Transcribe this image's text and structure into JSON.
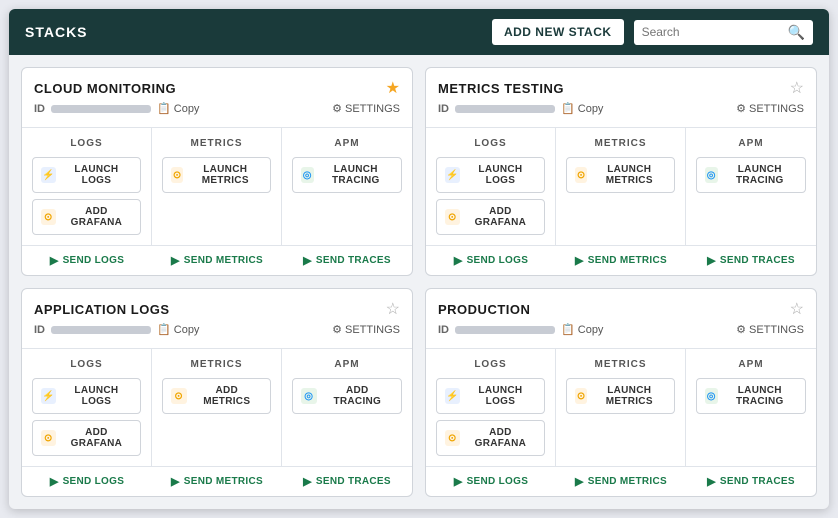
{
  "header": {
    "title": "STACKS",
    "add_button_label": "ADD NEW STACK",
    "search_placeholder": "Search"
  },
  "stacks": [
    {
      "id": "cloud-monitoring",
      "name": "CLOUD MONITORING",
      "starred": true,
      "id_label": "ID",
      "copy_label": "Copy",
      "settings_label": "SETTINGS",
      "services": [
        {
          "title": "LOGS",
          "buttons": [
            {
              "label": "LAUNCH LOGS",
              "type": "logs"
            },
            {
              "label": "ADD GRAFANA",
              "type": "grafana"
            }
          ]
        },
        {
          "title": "METRICS",
          "buttons": [
            {
              "label": "LAUNCH METRICS",
              "type": "metrics"
            }
          ]
        },
        {
          "title": "APM",
          "buttons": [
            {
              "label": "LAUNCH TRACING",
              "type": "apm"
            }
          ]
        }
      ],
      "send_buttons": [
        "SEND LOGS",
        "SEND METRICS",
        "SEND TRACES"
      ]
    },
    {
      "id": "metrics-testing",
      "name": "METRICS TESTING",
      "starred": false,
      "id_label": "ID",
      "copy_label": "Copy",
      "settings_label": "SETTINGS",
      "services": [
        {
          "title": "LOGS",
          "buttons": [
            {
              "label": "LAUNCH LOGS",
              "type": "logs"
            },
            {
              "label": "ADD GRAFANA",
              "type": "grafana"
            }
          ]
        },
        {
          "title": "METRICS",
          "buttons": [
            {
              "label": "LAUNCH METRICS",
              "type": "metrics"
            }
          ]
        },
        {
          "title": "APM",
          "buttons": [
            {
              "label": "LAUNCH TRACING",
              "type": "apm"
            }
          ]
        }
      ],
      "send_buttons": [
        "SEND LOGS",
        "SEND METRICS",
        "SEND TRACES"
      ]
    },
    {
      "id": "application-logs",
      "name": "APPLICATION LOGS",
      "starred": false,
      "id_label": "ID",
      "copy_label": "Copy",
      "settings_label": "SETTINGS",
      "services": [
        {
          "title": "LOGS",
          "buttons": [
            {
              "label": "LAUNCH LOGS",
              "type": "logs"
            },
            {
              "label": "ADD GRAFANA",
              "type": "grafana"
            }
          ]
        },
        {
          "title": "METRICS",
          "buttons": [
            {
              "label": "ADD METRICS",
              "type": "metrics"
            }
          ]
        },
        {
          "title": "APM",
          "buttons": [
            {
              "label": "ADD TRACING",
              "type": "apm"
            }
          ]
        }
      ],
      "send_buttons": [
        "SEND LOGS",
        "SEND METRICS",
        "SEND TRACES"
      ]
    },
    {
      "id": "production",
      "name": "PRODUCTION",
      "starred": false,
      "id_label": "ID",
      "copy_label": "Copy",
      "settings_label": "SETTINGS",
      "services": [
        {
          "title": "LOGS",
          "buttons": [
            {
              "label": "LAUNCH LOGS",
              "type": "logs"
            },
            {
              "label": "ADD GRAFANA",
              "type": "grafana"
            }
          ]
        },
        {
          "title": "METRICS",
          "buttons": [
            {
              "label": "LAUNCH METRICS",
              "type": "metrics"
            }
          ]
        },
        {
          "title": "APM",
          "buttons": [
            {
              "label": "LAUNCH TRACING",
              "type": "apm"
            }
          ]
        }
      ],
      "send_buttons": [
        "SEND LOGS",
        "SEND METRICS",
        "SEND TRACES"
      ]
    }
  ]
}
